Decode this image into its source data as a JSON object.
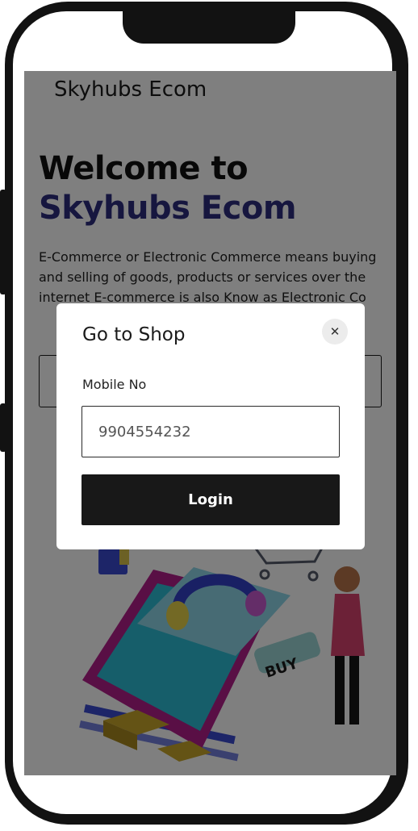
{
  "app": {
    "title": "Skyhubs Ecom"
  },
  "hero": {
    "line1": "Welcome to",
    "line2": "Skyhubs Ecom",
    "description": "E-Commerce or Electronic Commerce means buying and selling of goods, products or services over the internet E-commerce is also Know as Electronic Co"
  },
  "illustration": {
    "buy_label": "BUY"
  },
  "modal": {
    "title": "Go to Shop",
    "close_symbol": "✕",
    "mobile_label": "Mobile No",
    "mobile_value": "9904554232",
    "login_label": "Login"
  },
  "colors": {
    "accent": "#2d2d7e",
    "button": "#181818",
    "frame": "#121212"
  }
}
